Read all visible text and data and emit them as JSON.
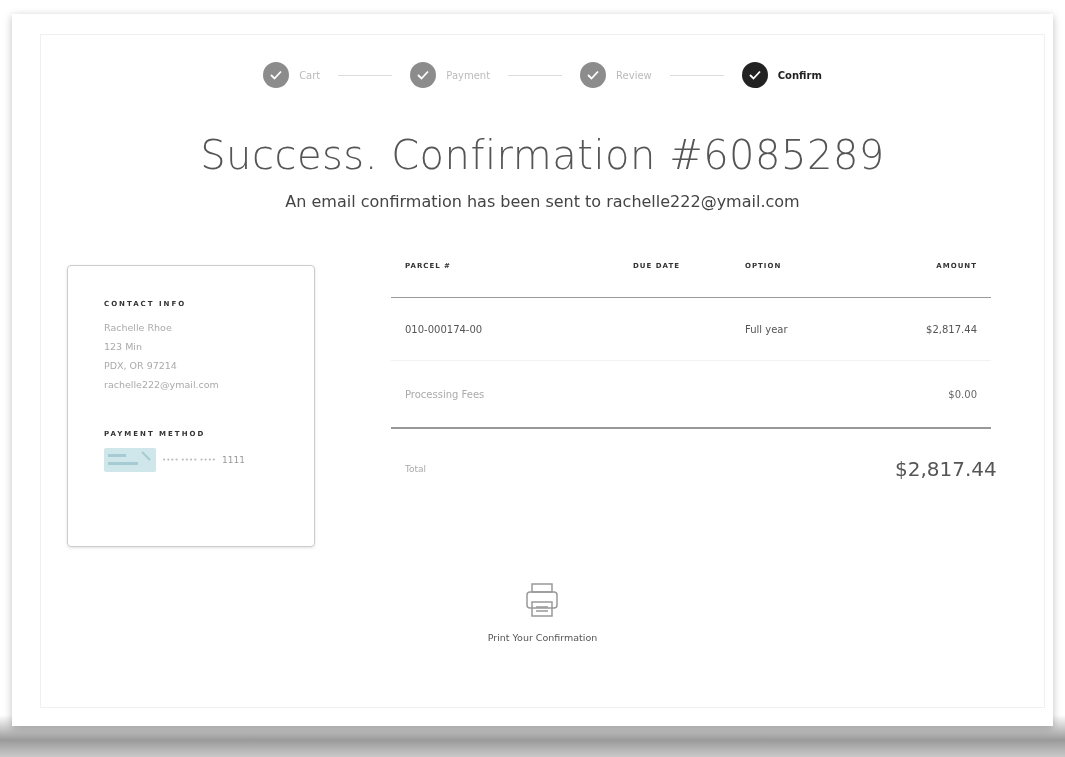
{
  "steps": [
    {
      "label": "Cart",
      "selected": false
    },
    {
      "label": "Payment",
      "selected": false
    },
    {
      "label": "Review",
      "selected": false
    },
    {
      "label": "Confirm",
      "selected": true
    }
  ],
  "title": "Success. Confirmation #6085289",
  "subtitle": "An email confirmation has been sent to rachelle222@ymail.com",
  "contact": {
    "heading": "CONTACT INFO",
    "lines": [
      "Rachelle Rhoe",
      "123 Min",
      "PDX, OR 97214",
      "rachelle222@ymail.com"
    ]
  },
  "payment": {
    "heading": "PAYMENT METHOD",
    "masked": "•••• •••• ••••",
    "last4": "1111"
  },
  "table": {
    "columns": [
      "PARCEL #",
      "DUE DATE",
      "OPTION",
      "AMOUNT"
    ],
    "rows": [
      {
        "kind": "item",
        "cells": [
          "010-000174-00",
          "",
          "Full year",
          "$2,817.44"
        ]
      },
      {
        "kind": "fee",
        "cells": [
          "Processing Fees",
          "",
          "",
          "$0.00"
        ]
      },
      {
        "kind": "total",
        "cells": [
          "Total",
          "",
          "",
          "$2,817.44"
        ]
      }
    ]
  },
  "print": {
    "label": "Print Your Confirmation"
  }
}
